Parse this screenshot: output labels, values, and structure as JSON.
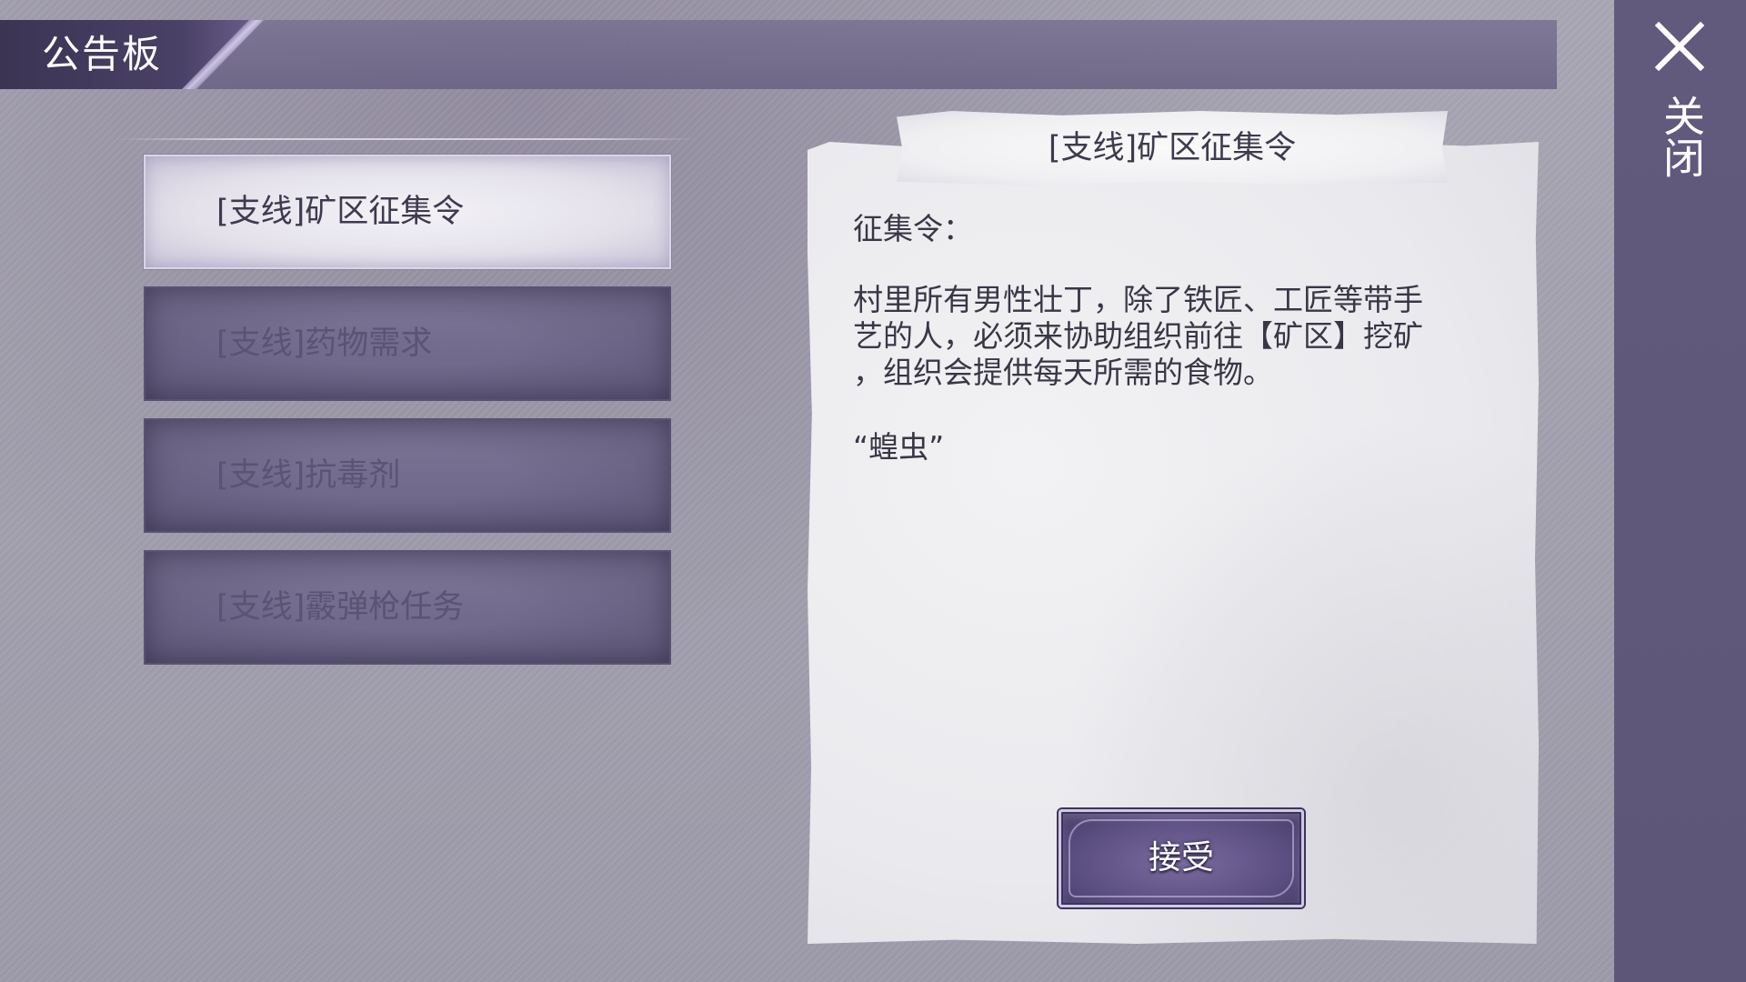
{
  "header": {
    "title": "公告板"
  },
  "close": {
    "label": "关闭",
    "icon": "close-icon"
  },
  "quest_list": [
    {
      "label": "[支线]矿区征集令",
      "selected": true
    },
    {
      "label": "[支线]药物需求",
      "selected": false
    },
    {
      "label": "[支线]抗毒剂",
      "selected": false
    },
    {
      "label": "[支线]霰弹枪任务",
      "selected": false
    }
  ],
  "notice": {
    "title": "[支线]矿区征集令",
    "heading": "征集令：",
    "body_lines": [
      "村里所有男性壮丁，除了铁匠、工匠等带手",
      "艺的人，必须来协助组织前往【矿区】挖矿",
      "，组织会提供每天所需的食物。"
    ],
    "signature": "“蝗虫”",
    "accept_label": "接受"
  },
  "colors": {
    "accent": "#5c4f82",
    "header_bar": "#6e6790",
    "close_strip": "#625a7d",
    "paper": "#ececf0",
    "text_dark": "#3a3646"
  }
}
